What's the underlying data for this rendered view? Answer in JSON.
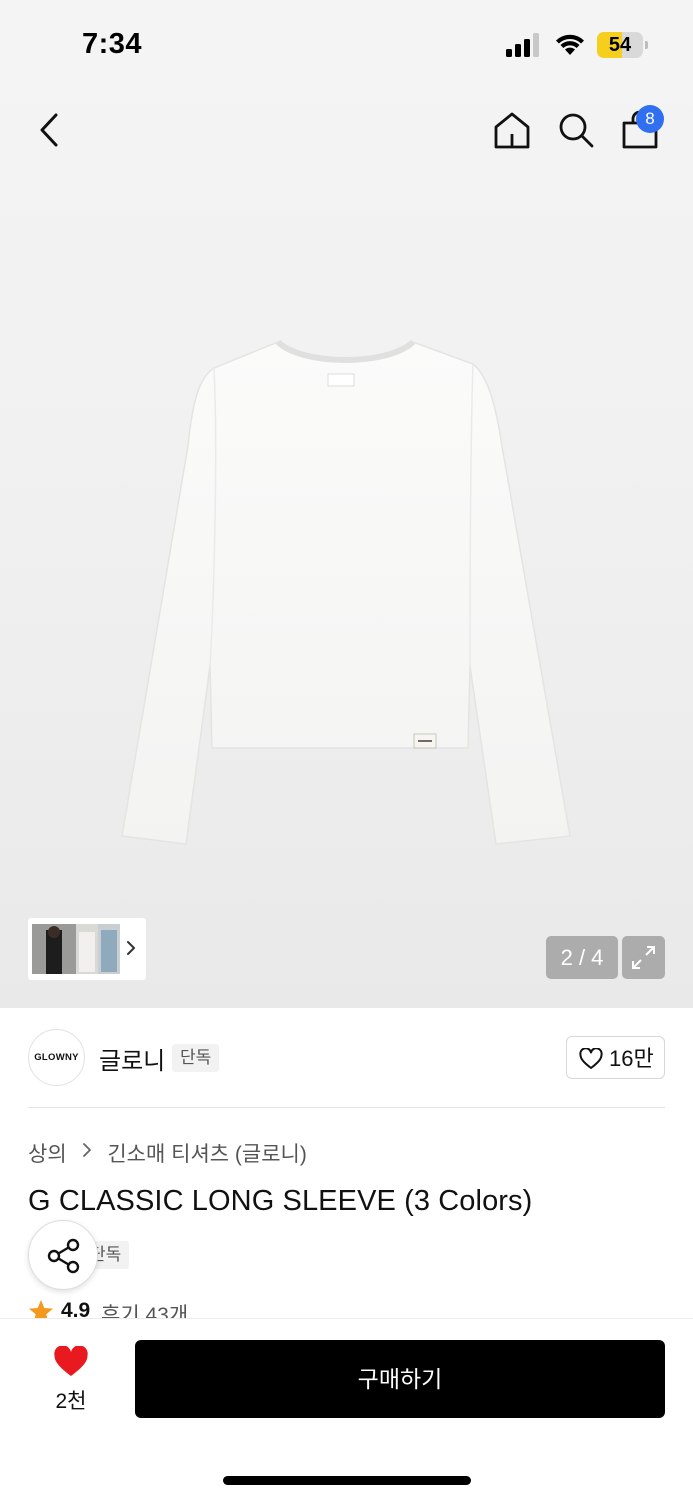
{
  "status_bar": {
    "time": "7:34",
    "battery": "54",
    "battery_level": 0.54
  },
  "nav": {
    "cart_count": "8"
  },
  "gallery": {
    "page_indicator": "2 / 4"
  },
  "brand": {
    "logo_text": "GLOWNY",
    "name": "글로니",
    "tag": "단독",
    "likes": "16만"
  },
  "breadcrumb": {
    "category": "상의",
    "subcategory": "긴소매 티셔츠 (글로니)"
  },
  "product": {
    "title": "G CLASSIC LONG SLEEVE (3 Colors)",
    "exclusive_tag": "단독",
    "rating": "4.9",
    "reviews": "후기 43개"
  },
  "bottom_bar": {
    "wish_count": "2천",
    "buy_label": "구매하기"
  },
  "colors": {
    "accent_badge": "#2f6ff0",
    "heart_red": "#e8191f",
    "star_orange": "#f39a1e",
    "buy_bg": "#000000"
  }
}
